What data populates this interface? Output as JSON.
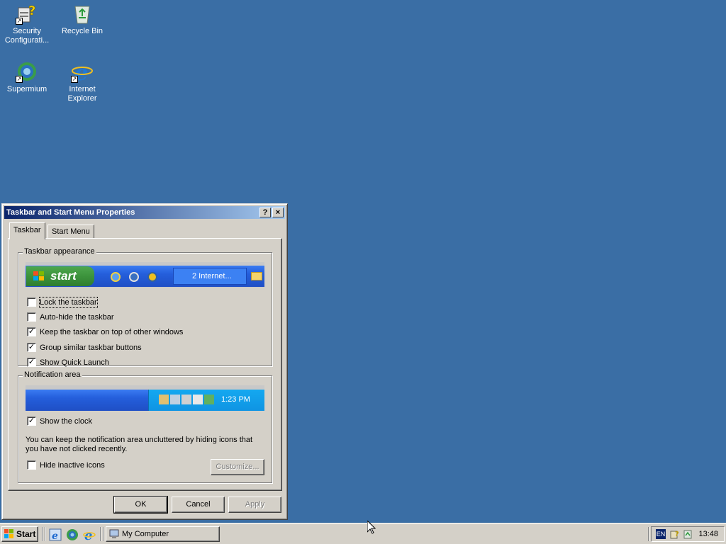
{
  "desktop": {
    "icons": [
      {
        "label": "Security Configurati...",
        "icon": "security-config-icon"
      },
      {
        "label": "Recycle Bin",
        "icon": "recycle-bin-icon"
      },
      {
        "label": "Supermium",
        "icon": "supermium-icon"
      },
      {
        "label": "Internet Explorer",
        "icon": "internet-explorer-icon"
      }
    ]
  },
  "dialog": {
    "title": "Taskbar and Start Menu Properties",
    "help_glyph": "?",
    "close_glyph": "×",
    "tabs": [
      {
        "label": "Taskbar",
        "active": true
      },
      {
        "label": "Start Menu",
        "active": false
      }
    ],
    "appearance": {
      "title": "Taskbar appearance",
      "preview": {
        "start_label": "start",
        "group_label": "2 Internet..."
      },
      "options": [
        {
          "label": "Lock the taskbar",
          "checked": false
        },
        {
          "label": "Auto-hide the taskbar",
          "checked": false
        },
        {
          "label": "Keep the taskbar on top of other windows",
          "checked": true
        },
        {
          "label": "Group similar taskbar buttons",
          "checked": true
        },
        {
          "label": "Show Quick Launch",
          "checked": true
        }
      ]
    },
    "notification": {
      "title": "Notification area",
      "preview_time": "1:23 PM",
      "show_clock": {
        "label": "Show the clock",
        "checked": true
      },
      "hint": "You can keep the notification area uncluttered by hiding icons that you have not clicked recently.",
      "hide_inactive": {
        "label": "Hide inactive icons",
        "checked": false
      },
      "customize_label": "Customize..."
    },
    "buttons": {
      "ok": "OK",
      "cancel": "Cancel",
      "apply": "Apply"
    }
  },
  "taskbar": {
    "start_label": "Start",
    "quick_launch": [
      "ie-icon",
      "supermium-icon",
      "internet-explorer-icon"
    ],
    "tasks": [
      {
        "label": "My Computer",
        "icon": "my-computer-icon"
      }
    ],
    "tray": {
      "lang": "EN",
      "clock": "13:48"
    }
  },
  "colors": {
    "desktop": "#3a6ea5",
    "titlebar": "#0a246a",
    "face": "#d4d0c8"
  }
}
